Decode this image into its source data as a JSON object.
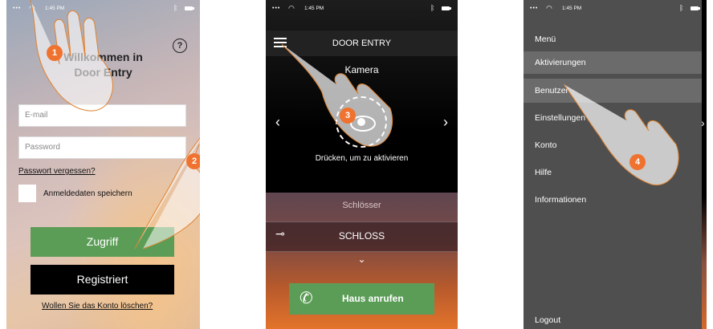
{
  "status_bar": {
    "signal": "•••",
    "time": "1:45 PM"
  },
  "login_screen": {
    "title_line1": "Willkommen in",
    "title_line2": "Door Entry",
    "help_icon": "help-headset-icon",
    "email_placeholder": "E-mail",
    "password_placeholder": "Password",
    "forgot_password": "Passwort vergessen?",
    "remember_label": "Anmeldedaten speichern",
    "login_button": "Zugriff",
    "register_button": "Registriert",
    "delete_account_link": "Wollen Sie das Konto löschen?",
    "colors": {
      "login": "#5b9d56",
      "register": "#000000"
    }
  },
  "door_entry_screen": {
    "header_title": "DOOR ENTRY",
    "camera_label": "Kamera",
    "activate_text": "Drücken, um zu aktivieren",
    "locks_title": "Schlösser",
    "lock_name": "SCHLOSS",
    "call_button": "Haus anrufen",
    "icons": {
      "menu": "hamburger-menu-icon",
      "eye": "eye-icon",
      "key": "key-icon",
      "phone": "phone-icon"
    }
  },
  "menu_screen": {
    "items": [
      {
        "label": "Menü"
      },
      {
        "label": "Aktivierungen"
      },
      {
        "label": "Benutzer"
      },
      {
        "label": "Einstellungen"
      },
      {
        "label": "Konto"
      },
      {
        "label": "Hilfe"
      },
      {
        "label": "Informationen"
      },
      {
        "label": "Logout"
      }
    ]
  },
  "step_badges": [
    "1",
    "2",
    "3",
    "4"
  ]
}
